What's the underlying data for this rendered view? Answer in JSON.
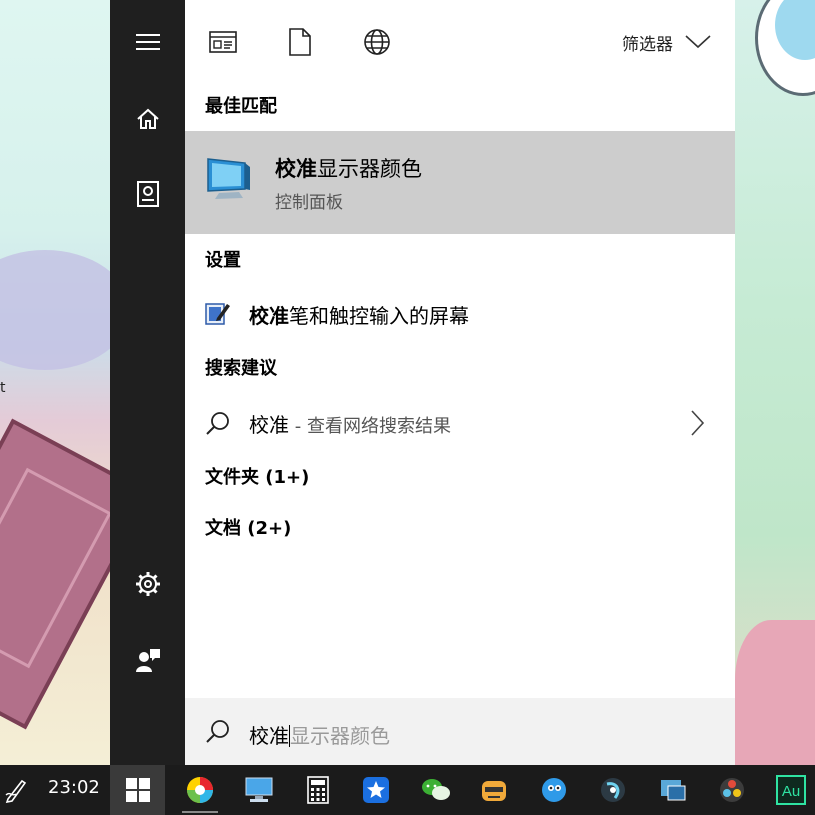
{
  "filter_bar": {
    "icons": [
      "apps-filter-icon",
      "documents-filter-icon",
      "web-filter-icon"
    ],
    "filter_label": "筛选器"
  },
  "sections": {
    "best_match": "最佳匹配",
    "settings": "设置",
    "search_suggestions": "搜索建议",
    "folders": "文件夹 (1+)",
    "documents": "文档 (2+)"
  },
  "best_match": {
    "title_highlight": "校准",
    "title_rest": "显示器颜色",
    "subtitle": "控制面板"
  },
  "settings_item": {
    "highlight": "校准",
    "rest": "笔和触控输入的屏幕"
  },
  "suggestion": {
    "query": "校准",
    "suffix": " - 查看网络搜索结果"
  },
  "search_box": {
    "typed": "校准",
    "hint": "显示器颜色"
  },
  "taskbar": {
    "clock": "23:02",
    "apps": [
      "color-app-icon",
      "computer-app-icon",
      "calculator-app-icon",
      "star-app-icon",
      "wechat-app-icon",
      "game-app-icon",
      "bird-app-icon",
      "media-app-icon",
      "remote-app-icon",
      "resolve-app-icon",
      "audition-app-icon"
    ],
    "audition_label": "Au"
  },
  "wallpaper_text": "t",
  "colors": {
    "rail": "#1f1f1f",
    "best_match_bg": "#cdcdcd",
    "taskbar": "#1b1b1b",
    "hint_text": "#9a9a9a"
  }
}
